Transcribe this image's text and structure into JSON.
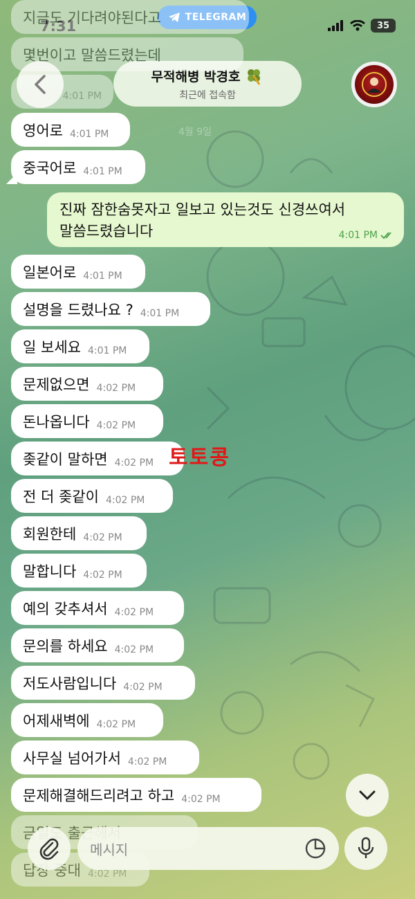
{
  "status_bar": {
    "time": "7:31",
    "app_pill": "TELEGRAM",
    "battery": "35"
  },
  "header": {
    "name": "무적해병 박경호",
    "status": "최근에 접속함"
  },
  "date_label": "4월 9일",
  "watermark": "토토콩",
  "messages_top_faded": [
    {
      "text": "지금도 기다려야된다고",
      "time": ""
    },
    {
      "text": "몇번이고 말씀드렸는데",
      "time": ""
    },
    {
      "text": "",
      "time": "4:01 PM"
    }
  ],
  "messages": [
    {
      "text": "영어로",
      "time": "4:01 PM"
    },
    {
      "text": "중국어로",
      "time": "4:01 PM"
    },
    {
      "text": "일본어로",
      "time": "4:01 PM"
    },
    {
      "text": "설명을 드렸나요 ?",
      "time": "4:01 PM"
    },
    {
      "text": "일 보세요",
      "time": "4:01 PM"
    },
    {
      "text": "문제없으면",
      "time": "4:02 PM"
    },
    {
      "text": "돈나옵니다",
      "time": "4:02 PM"
    },
    {
      "text": "좆같이 말하면",
      "time": "4:02 PM"
    },
    {
      "text": "전 더 좆같이",
      "time": "4:02 PM"
    },
    {
      "text": "회원한테",
      "time": "4:02 PM"
    },
    {
      "text": "말합니다",
      "time": "4:02 PM"
    },
    {
      "text": "예의 갖추셔서",
      "time": "4:02 PM"
    },
    {
      "text": "문의를 하세요",
      "time": "4:02 PM"
    },
    {
      "text": "저도사람입니다",
      "time": "4:02 PM"
    },
    {
      "text": "어제새벽에",
      "time": "4:02 PM"
    },
    {
      "text": "사무실 넘어가서",
      "time": "4:02 PM"
    },
    {
      "text": "문제해결해드리려고 하고",
      "time": "4:02 PM"
    }
  ],
  "messages_bottom_faded": [
    {
      "text": "금일도 출근해서",
      "time": ""
    },
    {
      "text": "답장 중대",
      "time": "4:02 PM"
    }
  ],
  "outgoing": {
    "text_line1": "진짜 잠한숨못자고 일보고 있는것도 신경쓰여서",
    "text_line2": "말씀드렸습니다",
    "time": "4:01 PM"
  },
  "composer": {
    "placeholder": "메시지"
  }
}
